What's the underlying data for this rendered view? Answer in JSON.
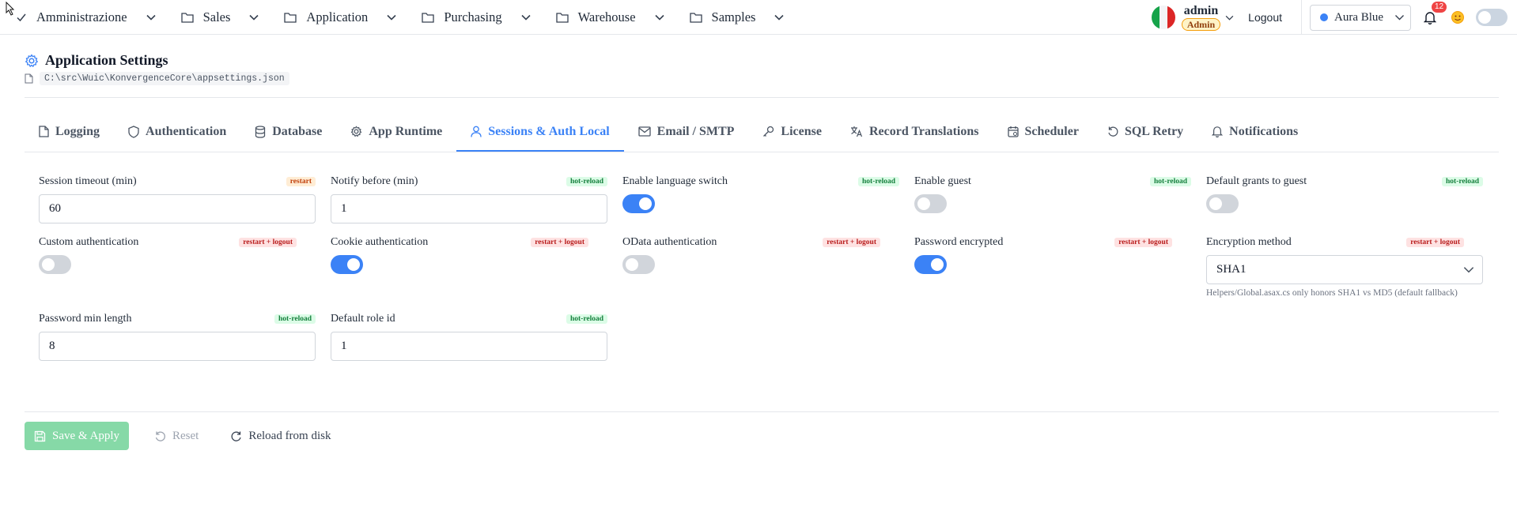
{
  "nav": {
    "items": [
      {
        "label": "Amministrazione",
        "icon": "check-icon"
      },
      {
        "label": "Sales",
        "icon": "folder-icon"
      },
      {
        "label": "Application",
        "icon": "folder-icon"
      },
      {
        "label": "Purchasing",
        "icon": "folder-icon"
      },
      {
        "label": "Warehouse",
        "icon": "folder-icon"
      },
      {
        "label": "Samples",
        "icon": "folder-icon"
      }
    ]
  },
  "user": {
    "name": "admin",
    "role": "Admin",
    "logout": "Logout",
    "flag": "italy-flag-icon"
  },
  "theme": {
    "selected": "Aura Blue",
    "color": "#3b82f6"
  },
  "notifications": {
    "count": "12"
  },
  "header": {
    "title": "Application Settings",
    "path": "C:\\src\\Wuic\\KonvergenceCore\\appsettings.json"
  },
  "tabs": [
    {
      "label": "Logging",
      "icon": "file-icon"
    },
    {
      "label": "Authentication",
      "icon": "shield-icon"
    },
    {
      "label": "Database",
      "icon": "database-icon"
    },
    {
      "label": "App Runtime",
      "icon": "gear-icon"
    },
    {
      "label": "Sessions & Auth Local",
      "icon": "user-icon",
      "active": true
    },
    {
      "label": "Email / SMTP",
      "icon": "mail-icon"
    },
    {
      "label": "License",
      "icon": "key-icon"
    },
    {
      "label": "Record Translations",
      "icon": "translate-icon"
    },
    {
      "label": "Scheduler",
      "icon": "calendar-icon"
    },
    {
      "label": "SQL Retry",
      "icon": "retry-icon"
    },
    {
      "label": "Notifications",
      "icon": "bell-icon"
    }
  ],
  "fields": {
    "session_timeout": {
      "label": "Session timeout (min)",
      "tag": "restart",
      "value": "60"
    },
    "notify_before": {
      "label": "Notify before (min)",
      "tag": "hot-reload",
      "value": "1"
    },
    "enable_language_switch": {
      "label": "Enable language switch",
      "tag": "hot-reload",
      "checked": true
    },
    "enable_guest": {
      "label": "Enable guest",
      "tag": "hot-reload",
      "checked": false
    },
    "default_grants_guest": {
      "label": "Default grants to guest",
      "tag": "hot-reload",
      "checked": false
    },
    "custom_auth": {
      "label": "Custom authentication",
      "tag": "restart + logout",
      "checked": false
    },
    "cookie_auth": {
      "label": "Cookie authentication",
      "tag": "restart + logout",
      "checked": true
    },
    "odata_auth": {
      "label": "OData authentication",
      "tag": "restart + logout",
      "checked": false
    },
    "password_encrypted": {
      "label": "Password encrypted",
      "tag": "restart + logout",
      "checked": true
    },
    "encryption_method": {
      "label": "Encryption method",
      "tag": "restart + logout",
      "value": "SHA1",
      "hint": "Helpers/Global.asax.cs only honors SHA1 vs MD5 (default fallback)"
    },
    "password_min_length": {
      "label": "Password min length",
      "tag": "hot-reload",
      "value": "8"
    },
    "default_role_id": {
      "label": "Default role id",
      "tag": "hot-reload",
      "value": "1"
    }
  },
  "actions": {
    "save": "Save & Apply",
    "reset": "Reset",
    "reload": "Reload from disk"
  },
  "colors": {
    "accent": "#3b82f6",
    "save_button": "#86d9a7"
  }
}
